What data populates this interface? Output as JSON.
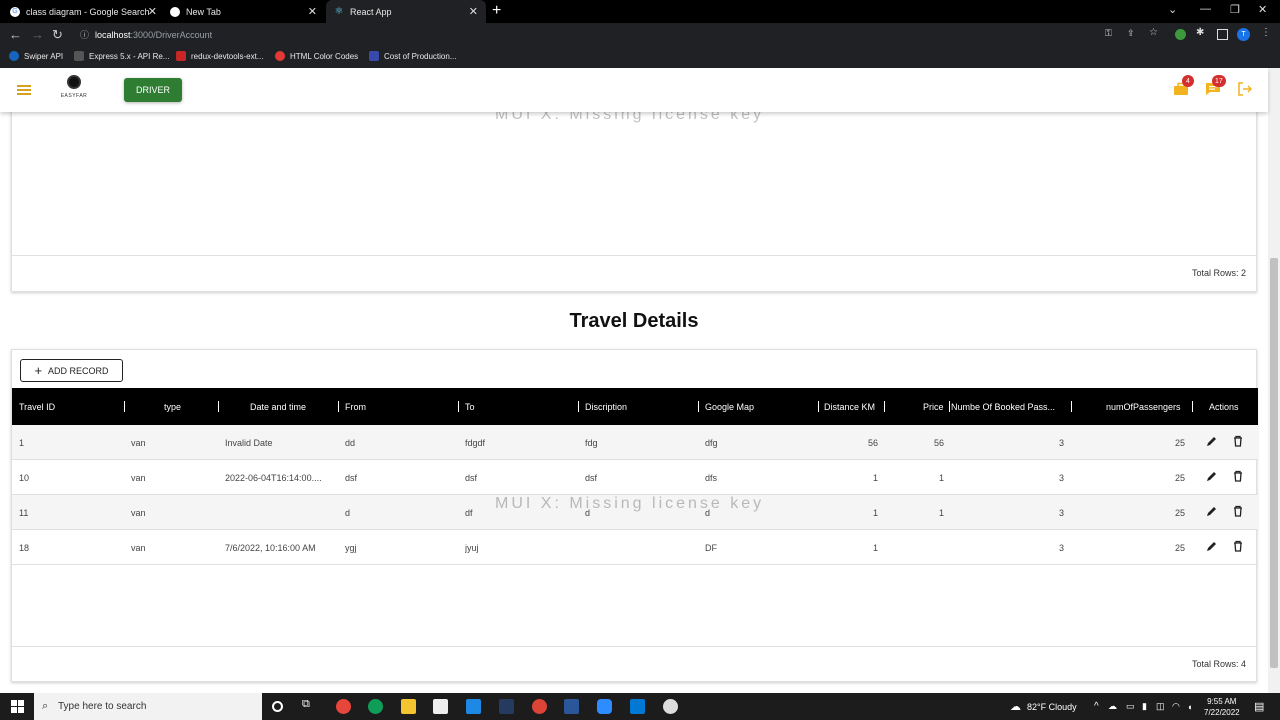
{
  "browser": {
    "tabs": [
      {
        "title": "class diagram - Google Search",
        "active": false,
        "icon": "google-icon"
      },
      {
        "title": "New Tab",
        "active": false,
        "icon": "chrome-icon"
      },
      {
        "title": "React App",
        "active": true,
        "icon": "react-icon"
      }
    ],
    "url_host": "localhost",
    "url_path": ":3000/DriverAccount",
    "bookmarks": [
      {
        "label": "Swiper API",
        "icon": "swiper-icon"
      },
      {
        "label": "Express 5.x - API Re...",
        "icon": "express-icon"
      },
      {
        "label": "redux-devtools-ext...",
        "icon": "redux-icon"
      },
      {
        "label": "HTML Color Codes",
        "icon": "html-color-icon"
      },
      {
        "label": "Cost of Production...",
        "icon": "cost-icon"
      }
    ],
    "profile_initial": "T"
  },
  "header": {
    "logo_text": "EASYFAR",
    "driver_button": "DRIVER",
    "badge_briefcase": "4",
    "badge_chat": "17"
  },
  "watermark": "MUI X: Missing license key",
  "upper_grid": {
    "total_rows": "Total Rows: 2"
  },
  "section_title": "Travel Details",
  "travel_grid": {
    "add_record": "ADD RECORD",
    "columns": [
      "Travel ID",
      "type",
      "Date and time",
      "From",
      "To",
      "Discription",
      "Google Map",
      "Distance KM",
      "Price",
      "Numbe Of Booked Pass...",
      "numOfPassengers",
      "Actions"
    ],
    "rows": [
      {
        "id": "1",
        "type": "van",
        "date": "Invalid Date",
        "from": "dd",
        "to": "fdgdf",
        "desc": "fdg",
        "map": "dfg",
        "distance": "56",
        "price": "56",
        "booked": "3",
        "passengers": "25"
      },
      {
        "id": "10",
        "type": "van",
        "date": "2022-06-04T16:14:00....",
        "from": "dsf",
        "to": "dsf",
        "desc": "dsf",
        "map": "dfs",
        "distance": "1",
        "price": "1",
        "booked": "3",
        "passengers": "25"
      },
      {
        "id": "11",
        "type": "van",
        "date": "",
        "from": "d",
        "to": "df",
        "desc": "d",
        "map": "d",
        "distance": "1",
        "price": "1",
        "booked": "3",
        "passengers": "25"
      },
      {
        "id": "18",
        "type": "van",
        "date": "7/6/2022, 10:16:00 AM",
        "from": "ygj",
        "to": "jyuj",
        "desc": "",
        "map": "DF",
        "distance": "1",
        "price": "",
        "booked": "3",
        "passengers": "25"
      }
    ],
    "total_rows": "Total Rows: 4"
  },
  "taskbar": {
    "search_placeholder": "Type here to search",
    "weather": "82°F  Cloudy",
    "time": "9:55 AM",
    "date": "7/22/2022"
  },
  "colors": {
    "accent_green": "#2e7d32",
    "icon_gold": "#f2b41e",
    "badge_red": "#d32f2f"
  }
}
